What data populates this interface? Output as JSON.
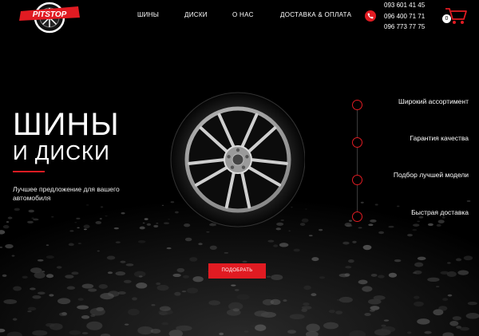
{
  "header": {
    "logo_text": "PITSTOP",
    "nav": [
      "ШИНЫ",
      "ДИСКИ",
      "О НАС",
      "ДОСТАВКА & ОПЛАТА"
    ],
    "phones": [
      "093 601 41 45",
      "096 400 71 71",
      "096 773 77 75"
    ],
    "cart_count": "0"
  },
  "hero": {
    "title_line1": "ШИНЫ",
    "title_line2": "И ДИСКИ",
    "subtitle": "Лучшее предложение для вашего автомобиля",
    "cta_label": "ПОДОБРАТЬ"
  },
  "features": [
    {
      "label": "Широкий ассортимент"
    },
    {
      "label": "Гарантия качества"
    },
    {
      "label": "Подбор лучшей модели"
    },
    {
      "label": "Быстрая доставка"
    }
  ],
  "colors": {
    "accent": "#e11b22",
    "background": "#000000",
    "text": "#ffffff"
  }
}
